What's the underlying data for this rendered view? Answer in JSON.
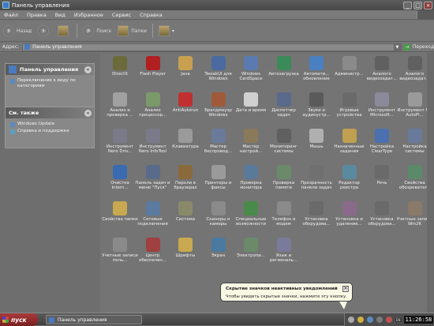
{
  "window": {
    "title": "Панель управления",
    "controls": [
      "_",
      "□",
      "×"
    ]
  },
  "menu": [
    "Файл",
    "Правка",
    "Вид",
    "Избранное",
    "Сервис",
    "Справка"
  ],
  "toolbar": {
    "back": "Назад",
    "search": "Поиск",
    "folders": "Папки"
  },
  "address": {
    "label": "Адрес:",
    "value": "Панель управления",
    "go": "Переход"
  },
  "sidebar": {
    "panel1": {
      "title": "Панель управления",
      "link": "Переключение к виду по категориям"
    },
    "panel2": {
      "title": "См. также",
      "links": [
        "Windows Update",
        "Справка и поддержка"
      ]
    }
  },
  "items": [
    {
      "label": "DirectX",
      "icon": "directx-icon",
      "color": "#6a6a3a"
    },
    {
      "label": "Flash Player",
      "icon": "flash-icon",
      "color": "#b02020"
    },
    {
      "label": "Java",
      "icon": "java-icon",
      "color": "#c8a050"
    },
    {
      "label": "TweakUI для Windows",
      "icon": "tweakui-icon",
      "color": "#4a6aa0"
    },
    {
      "label": "Windows CardSpace",
      "icon": "cardspace-icon",
      "color": "#5a7ab0"
    },
    {
      "label": "Автозагрузка",
      "icon": "autostart-icon",
      "color": "#3a8a5a"
    },
    {
      "label": "Автомати... обновление",
      "icon": "update-icon",
      "color": "#4a80c0"
    },
    {
      "label": "Администр...",
      "icon": "admin-icon",
      "color": "#8a8a8a"
    },
    {
      "label": "Аналого видеозадат...",
      "icon": "video-icon",
      "color": "#606060"
    },
    {
      "label": "Аналого видеозадат...",
      "icon": "video-icon",
      "color": "#606060"
    },
    {
      "label": "Анализ и проверка ...",
      "icon": "analysis-icon",
      "color": "#a0a0a0"
    },
    {
      "label": "Анализ процессор...",
      "icon": "cpu-icon",
      "color": "#7a9a6a"
    },
    {
      "label": "AntiAutorun",
      "icon": "antiautorun-icon",
      "color": "#c03030"
    },
    {
      "label": "Брандмауэр Windows",
      "icon": "firewall-icon",
      "color": "#a05a3a"
    },
    {
      "label": "Дата и время",
      "icon": "clock-icon",
      "color": "#d0d0d0"
    },
    {
      "label": "Диспетчер задач",
      "icon": "taskmgr-icon",
      "color": "#5a6a8a"
    },
    {
      "label": "Звуки и аудиоустр...",
      "icon": "sound-icon",
      "color": "#5a5a5a"
    },
    {
      "label": "Игровые устройства",
      "icon": "gamepad-icon",
      "color": "#6a6a6a"
    },
    {
      "label": "Инструмент Microsoft...",
      "icon": "tool-icon",
      "color": "#8a8a9a"
    },
    {
      "label": "Инструмент MS AutoPl...",
      "icon": "tool-icon",
      "color": "#9a9a9a"
    },
    {
      "label": "Инструмент Nero Driv...",
      "icon": "nero-icon",
      "color": "#7a7a8a"
    },
    {
      "label": "Инструмент Nero InfoTool",
      "icon": "nero-icon",
      "color": "#7a7a8a"
    },
    {
      "label": "Клавиатура",
      "icon": "keyboard-icon",
      "color": "#9a9a9a"
    },
    {
      "label": "Мастер беспровод...",
      "icon": "wireless-icon",
      "color": "#6a7a9a"
    },
    {
      "label": "Мастер настрой...",
      "icon": "wizard-icon",
      "color": "#8a7a5a"
    },
    {
      "label": "Мониторинг системы",
      "icon": "monitor-icon",
      "color": "#606060"
    },
    {
      "label": "Мышь",
      "icon": "mouse-icon",
      "color": "#b0b0b0"
    },
    {
      "label": "Назначенные задания",
      "icon": "tasks-icon",
      "color": "#c0a050"
    },
    {
      "label": "Настройка ClearType",
      "icon": "cleartype-icon",
      "color": "#4a70b0"
    },
    {
      "label": "Настройка системы",
      "icon": "settings-icon",
      "color": "#6a7a9a"
    },
    {
      "label": "Очистка Intern...",
      "icon": "ie-icon",
      "color": "#3a6ab0"
    },
    {
      "label": "Панель задач и меню \"Пуск\"",
      "icon": "taskbar-icon",
      "color": "#5a6a8a"
    },
    {
      "label": "Пароли в браузерах",
      "icon": "passwords-icon",
      "color": "#8a6a3a"
    },
    {
      "label": "Принтеры и факсы",
      "icon": "printer-icon",
      "color": "#9a9a9a"
    },
    {
      "label": "Проверка монитора",
      "icon": "monitor-icon",
      "color": "#5a7a9a"
    },
    {
      "label": "Проверка памяти",
      "icon": "memory-icon",
      "color": "#6a8a6a"
    },
    {
      "label": "Прозрачность панели задач",
      "icon": "transparency-icon",
      "color": "#707070"
    },
    {
      "label": "Редактор реестра",
      "icon": "regedit-icon",
      "color": "#5a8aa0"
    },
    {
      "label": "Речь",
      "icon": "speech-icon",
      "color": "#6a6a6a"
    },
    {
      "label": "Свойства обозревателя",
      "icon": "globe-icon",
      "color": "#5a8a6a"
    },
    {
      "label": "Свойства папки",
      "icon": "folder-icon",
      "color": "#c8a850"
    },
    {
      "label": "Сетевые подключения",
      "icon": "network-icon",
      "color": "#5a7aa0"
    },
    {
      "label": "Система",
      "icon": "system-icon",
      "color": "#8a8a6a"
    },
    {
      "label": "Сканеры и камеры",
      "icon": "scanner-icon",
      "color": "#8a8a8a"
    },
    {
      "label": "Специальные возможности",
      "icon": "accessibility-icon",
      "color": "#4a8a4a"
    },
    {
      "label": "Телефон и модем",
      "icon": "phone-icon",
      "color": "#8a8a8a"
    },
    {
      "label": "Установка оборудова...",
      "icon": "hardware-icon",
      "color": "#6a6a6a"
    },
    {
      "label": "Установка и удаление...",
      "icon": "addremove-icon",
      "color": "#8a6a8a"
    },
    {
      "label": "Установка оборудова...",
      "icon": "hardware-icon",
      "color": "#6a6a6a"
    },
    {
      "label": "Учетные записи Win2K",
      "icon": "users-icon",
      "color": "#8a7a6a"
    },
    {
      "label": "Учетные записи поль...",
      "icon": "users-icon",
      "color": "#8a8a8a"
    },
    {
      "label": "Центр обеспечен...",
      "icon": "security-icon",
      "color": "#a04040"
    },
    {
      "label": "Шрифты",
      "icon": "fonts-icon",
      "color": "#c8a850"
    },
    {
      "label": "Экран",
      "icon": "display-icon",
      "color": "#4a7aa0"
    },
    {
      "label": "Электропи...",
      "icon": "power-icon",
      "color": "#6a8a6a"
    },
    {
      "label": "Язык и региональ...",
      "icon": "language-icon",
      "color": "#7a7a9a"
    }
  ],
  "taskbar": {
    "start": "пуск",
    "task": "Панель управления",
    "clock": "11:26:58",
    "lang": "EN"
  },
  "balloon": {
    "title": "Скрытие значков неактивных уведомлений",
    "body": "Чтобы увидеть скрытые значки, нажмите эту кнопку.",
    "close": "✕"
  }
}
